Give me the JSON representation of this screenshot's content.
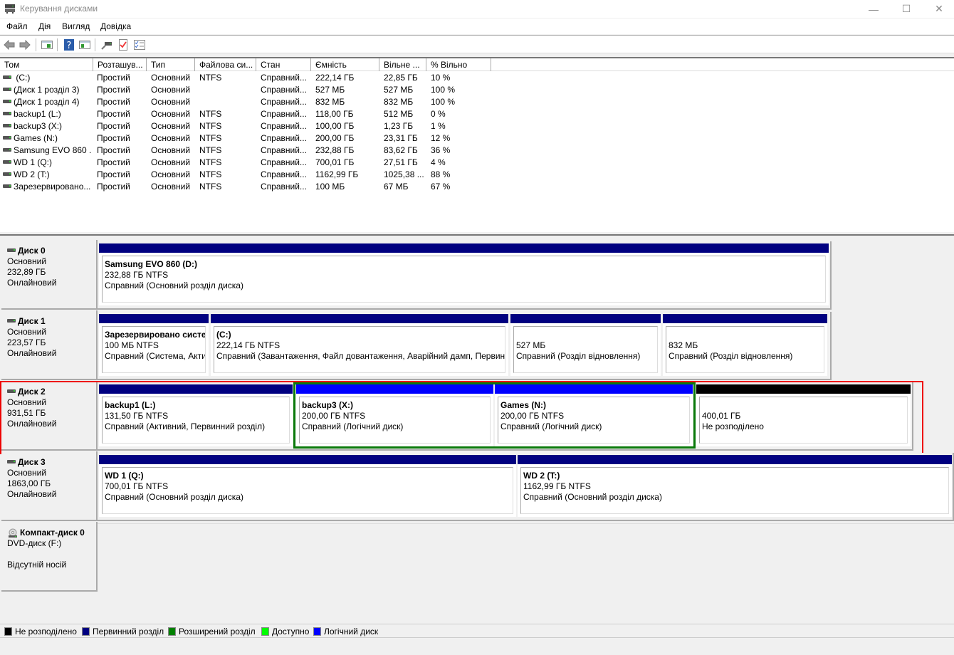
{
  "window": {
    "title": "Керування дисками",
    "minimize": "—",
    "maximize": "☐",
    "close": "✕"
  },
  "menu": [
    "Файл",
    "Дія",
    "Вигляд",
    "Довідка"
  ],
  "toolbar": {
    "icons": [
      "back-arrow-icon",
      "forward-arrow-icon",
      "show-hide-console-tree-icon",
      "help-icon",
      "show-hide-action-pane-icon",
      "connect-drive-icon",
      "properties-icon",
      "checklist-icon"
    ]
  },
  "volume_list": {
    "columns": [
      "Том",
      "Розташув...",
      "Тип",
      "Файлова си...",
      "Стан",
      "Ємність",
      "Вільне ...",
      "% Вільно"
    ],
    "rows": [
      [
        " (C:)",
        "Простий",
        "Основний",
        "NTFS",
        "Справний...",
        "222,14 ГБ",
        "22,85 ГБ",
        "10 %"
      ],
      [
        "(Диск 1 розділ 3)",
        "Простий",
        "Основний",
        "",
        "Справний...",
        "527 МБ",
        "527 МБ",
        "100 %"
      ],
      [
        "(Диск 1 розділ 4)",
        "Простий",
        "Основний",
        "",
        "Справний...",
        "832 МБ",
        "832 МБ",
        "100 %"
      ],
      [
        "backup1 (L:)",
        "Простий",
        "Основний",
        "NTFS",
        "Справний...",
        "118,00 ГБ",
        "512 МБ",
        "0 %"
      ],
      [
        "backup3 (X:)",
        "Простий",
        "Основний",
        "NTFS",
        "Справний...",
        "100,00 ГБ",
        "1,23 ГБ",
        "1 %"
      ],
      [
        "Games (N:)",
        "Простий",
        "Основний",
        "NTFS",
        "Справний...",
        "200,00 ГБ",
        "23,31 ГБ",
        "12 %"
      ],
      [
        "Samsung EVO 860 ...",
        "Простий",
        "Основний",
        "NTFS",
        "Справний...",
        "232,88 ГБ",
        "83,62 ГБ",
        "36 %"
      ],
      [
        "WD 1 (Q:)",
        "Простий",
        "Основний",
        "NTFS",
        "Справний...",
        "700,01 ГБ",
        "27,51 ГБ",
        "4 %"
      ],
      [
        "WD 2 (T:)",
        "Простий",
        "Основний",
        "NTFS",
        "Справний...",
        "1162,99 ГБ",
        "1025,38 ...",
        "88 %"
      ],
      [
        "Зарезервировано...",
        "Простий",
        "Основний",
        "NTFS",
        "Справний...",
        "100 МБ",
        "67 МБ",
        "67 %"
      ]
    ]
  },
  "disks": [
    {
      "name": "Диск 0",
      "type": "Основний",
      "size": "232,89 ГБ",
      "status": "Онлайновий",
      "partitions": [
        {
          "name": "Samsung EVO 860  (D:)",
          "size": "232,88 ГБ NTFS",
          "status": "Справний (Основний розділ диска)",
          "kind": "primary"
        }
      ]
    },
    {
      "name": "Диск 1",
      "type": "Основний",
      "size": "223,57 ГБ",
      "status": "Онлайновий",
      "partitions": [
        {
          "name": "Зарезервировано систем",
          "size": "100 МБ NTFS",
          "status": "Справний (Система, Акти",
          "kind": "primary"
        },
        {
          "name": "  (C:)",
          "size": "222,14 ГБ NTFS",
          "status": "Справний (Завантаження, Файл довантаження, Аварійний дамп, Первинн",
          "kind": "primary"
        },
        {
          "name": "",
          "size": "527 МБ",
          "status": "Справний (Розділ відновлення)",
          "kind": "primary"
        },
        {
          "name": "",
          "size": "832 МБ",
          "status": "Справний (Розділ відновлення)",
          "kind": "primary"
        }
      ]
    },
    {
      "name": "Диск 2",
      "type": "Основний",
      "size": "931,51 ГБ",
      "status": "Онлайновий",
      "partitions": [
        {
          "name": "backup1  (L:)",
          "size": "131,50 ГБ NTFS",
          "status": "Справний (Активний, Первинний розділ)",
          "kind": "primary"
        },
        {
          "name": "backup3  (X:)",
          "size": "200,00 ГБ NTFS",
          "status": "Справний (Логічний диск)",
          "kind": "logical"
        },
        {
          "name": "Games  (N:)",
          "size": "200,00 ГБ NTFS",
          "status": "Справний (Логічний диск)",
          "kind": "logical"
        },
        {
          "name": "",
          "size": "400,01 ГБ",
          "status": "Не розподілено",
          "kind": "unallocated"
        }
      ]
    },
    {
      "name": "Диск 3",
      "type": "Основний",
      "size": "1863,00 ГБ",
      "status": "Онлайновий",
      "partitions": [
        {
          "name": "WD 1  (Q:)",
          "size": "700,01 ГБ NTFS",
          "status": "Справний (Основний розділ диска)",
          "kind": "primary"
        },
        {
          "name": "WD 2  (T:)",
          "size": "1162,99 ГБ NTFS",
          "status": "Справний (Основний розділ диска)",
          "kind": "primary"
        }
      ]
    }
  ],
  "cdrom": {
    "name": "Компакт-диск 0",
    "type": "DVD-диск (F:)",
    "status": "Відсутній носій"
  },
  "legend": [
    {
      "label": "Не розподілено",
      "color": "#000000"
    },
    {
      "label": "Первинний розділ",
      "color": "#000080"
    },
    {
      "label": "Розширений розділ",
      "color": "#008000"
    },
    {
      "label": "Доступно",
      "color": "#00ff00"
    },
    {
      "label": "Логічний диск",
      "color": "#0000ff"
    }
  ],
  "colors": {
    "primary": "#000080",
    "logical": "#0000ff",
    "unallocated": "#000000",
    "extended_border": "#0a7a0a",
    "highlight": "#ee0000"
  }
}
